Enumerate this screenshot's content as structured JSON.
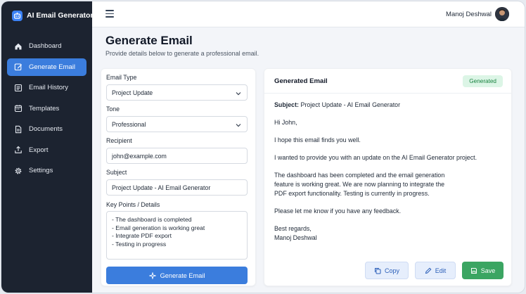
{
  "app": {
    "name": "AI Email Generator",
    "accent": "#3b7ddd",
    "sidebar_bg": "#1c2330"
  },
  "sidebar": {
    "items": [
      {
        "label": "Dashboard",
        "icon": "home-icon",
        "active": false
      },
      {
        "label": "Generate Email",
        "icon": "edit-square-icon",
        "active": true
      },
      {
        "label": "Email History",
        "icon": "list-icon",
        "active": false
      },
      {
        "label": "Templates",
        "icon": "calendar-icon",
        "active": false
      },
      {
        "label": "Documents",
        "icon": "document-icon",
        "active": false
      },
      {
        "label": "Export",
        "icon": "export-icon",
        "active": false
      },
      {
        "label": "Settings",
        "icon": "gear-icon",
        "active": false
      }
    ]
  },
  "topbar": {
    "user_name": "Manoj Deshwal",
    "menu_icon": "hamburger-icon"
  },
  "page": {
    "title": "Generate Email",
    "subtitle": "Provide details below to generate a professional email."
  },
  "form": {
    "email_type": {
      "label": "Email Type",
      "value": "Project Update"
    },
    "tone": {
      "label": "Tone",
      "value": "Professional"
    },
    "recipient": {
      "label": "Recipient",
      "value": "john@example.com"
    },
    "subject": {
      "label": "Subject",
      "value": "Project Update - AI Email Generator"
    },
    "key_points": {
      "label": "Key Points / Details",
      "lines": [
        "- The dashboard is completed",
        "- Email generation is working great",
        "- Integrate PDF export",
        "- Testing in progress"
      ]
    },
    "generate_label": "Generate Email"
  },
  "output": {
    "title": "Generated Email",
    "status": "Generated",
    "subject_label": "Subject:",
    "subject_value": "Project Update - AI Email Generator",
    "greeting": "Hi John,",
    "p1": "I hope this email finds you well.",
    "p2": "I wanted to provide you with an update on the AI Email Generator project.",
    "p3": [
      "The dashboard has been completed and the email generation",
      "feature is working great. We are now planning to integrate the",
      "PDF export functionality. Testing is currently in progress."
    ],
    "p4": "Please let me know if you have any feedback.",
    "signoff": "Best regards,",
    "signature": "Manoj Deshwal",
    "actions": {
      "copy": "Copy",
      "edit": "Edit",
      "save": "Save"
    }
  }
}
